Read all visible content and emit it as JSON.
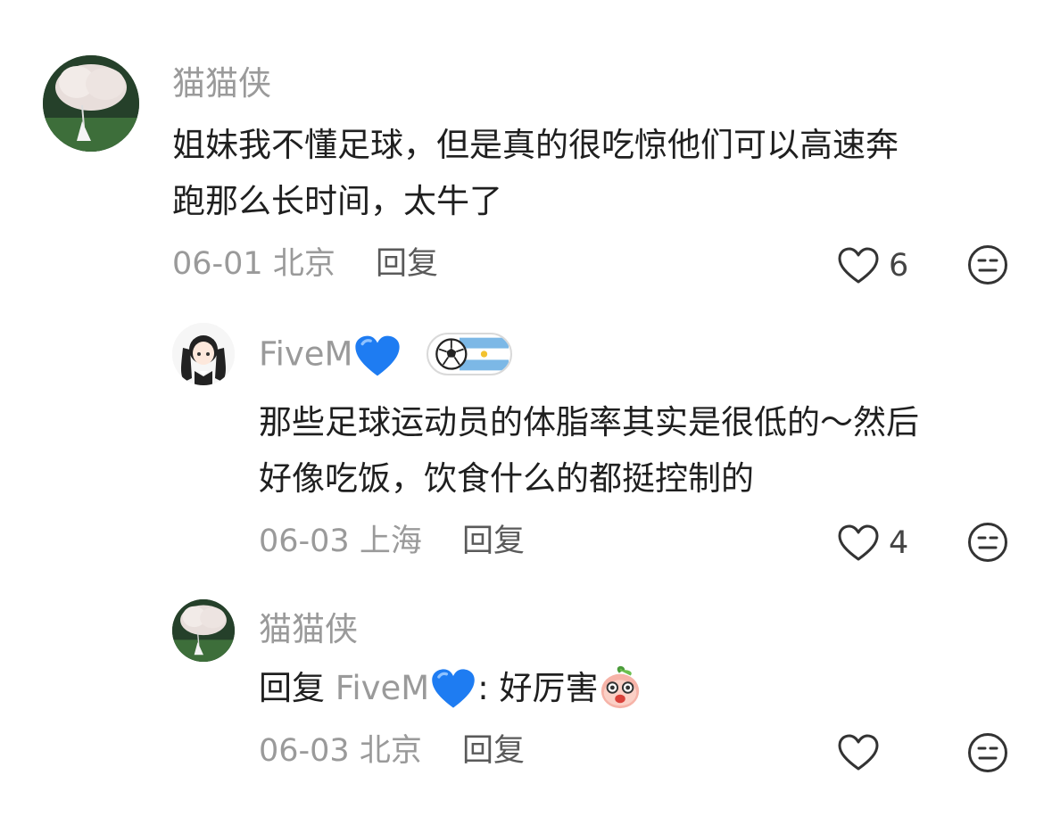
{
  "comments": [
    {
      "username": "猫猫侠",
      "text_line1": "姐妹我不懂足球，但是真的很吃惊他们可以高速奔",
      "text_line2": "跑那么长时间，太牛了",
      "date": "06-01",
      "location": "北京",
      "reply_label": "回复",
      "like_count": "6"
    },
    {
      "username": "FiveM",
      "badge_emoji": "blue-heart",
      "flag_badge": "soccer-ball-argentina-flag",
      "text_line1": "那些足球运动员的体脂率其实是很低的～然后",
      "text_line2": "好像吃饭，饮食什么的都挺控制的",
      "date": "06-03",
      "location": "上海",
      "reply_label": "回复",
      "like_count": "4"
    },
    {
      "username": "猫猫侠",
      "reply_prefix": "回复",
      "reply_to": "FiveM",
      "reply_text": ": 好厉害",
      "trailing_emoji": "surprised-peach-emoji",
      "date": "06-03",
      "location": "北京",
      "reply_label": "回复",
      "like_count": ""
    }
  ],
  "colors": {
    "meta_gray": "#9a9a9a",
    "heart_blue": "#1e7cf2",
    "text": "#1f1f1f"
  }
}
